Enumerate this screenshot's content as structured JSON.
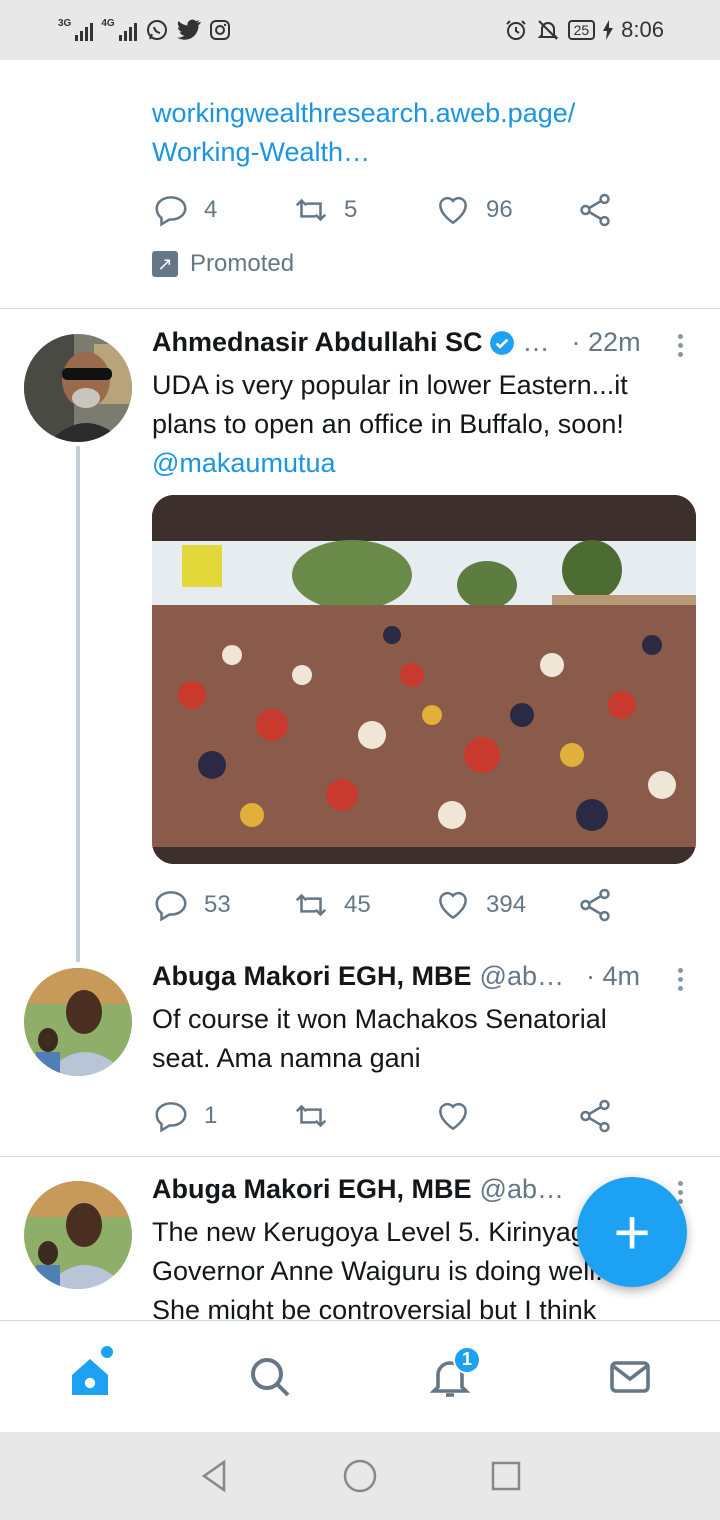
{
  "status_bar": {
    "network_1": "3G",
    "network_2": "4G",
    "battery": "25",
    "time": "8:06",
    "icons": [
      "whatsapp-icon",
      "twitter-icon",
      "instagram-icon",
      "alarm-icon",
      "mute-icon",
      "battery-icon",
      "charging-icon"
    ]
  },
  "promo_tweet": {
    "link_line1": "workingwealthresearch.aweb.page/",
    "link_line2": "Working-Wealth…",
    "replies": "4",
    "retweets": "5",
    "likes": "96",
    "promoted_label": "Promoted"
  },
  "tweets": [
    {
      "name": "Ahmednasir Abdullahi SC",
      "handle": "…",
      "time": "· 22m",
      "text_line1": "UDA is very popular in lower Eastern...it",
      "text_line2": "plans to open an office in Buffalo, soon!",
      "mention": "@makaumutua",
      "replies": "53",
      "retweets": "45",
      "likes": "394"
    },
    {
      "name": "Abuga Makori EGH, MBE",
      "handle": "@ab…",
      "time": "· 4m",
      "text_line1": "Of course it won Machakos Senatorial",
      "text_line2": "seat. Ama namna gani",
      "replies": "1"
    },
    {
      "name": "Abuga Makori EGH, MBE",
      "handle": "@ab…",
      "text_line1": "The new Kerugoya Level 5. Kirinyaga",
      "text_line2": "Governor Anne Waiguru is doing well.",
      "text_line3": "She might be controversial but I think"
    }
  ],
  "bottom_nav": {
    "notifications_badge": "1"
  },
  "colors": {
    "accent": "#1da1f2",
    "link": "#1b95e0",
    "muted": "#657786"
  }
}
